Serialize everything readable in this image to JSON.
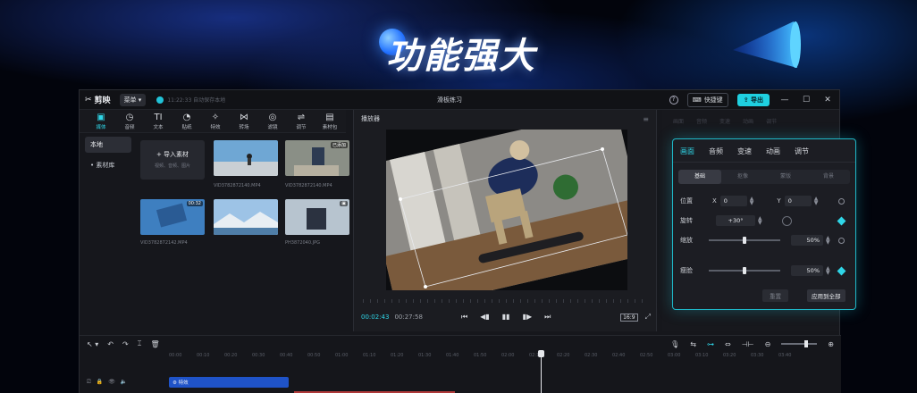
{
  "headline": "功能强大",
  "app": {
    "name": "剪映",
    "menu_label": "菜单",
    "save_status": "11:22:33 自动保存本地",
    "project_title": "滑板练习",
    "shortcut_label": "快捷键",
    "export_label": "导出",
    "help_glyph": "?",
    "minimize_glyph": "—",
    "maximize_glyph": "☐",
    "close_glyph": "✕"
  },
  "toolbar": {
    "items": [
      {
        "icon": "▣",
        "label": "媒体"
      },
      {
        "icon": "◷",
        "label": "音频"
      },
      {
        "icon": "TI",
        "label": "文本"
      },
      {
        "icon": "◔",
        "label": "贴纸"
      },
      {
        "icon": "✧",
        "label": "特效"
      },
      {
        "icon": "⋈",
        "label": "转场"
      },
      {
        "icon": "◎",
        "label": "滤镜"
      },
      {
        "icon": "⇌",
        "label": "调节"
      },
      {
        "icon": "▤",
        "label": "素材包"
      }
    ]
  },
  "left_nav": {
    "items": [
      "本地",
      "• 素材库"
    ]
  },
  "media": {
    "import_label": "+ 导入素材",
    "import_sub": "视频、音频、图片",
    "clips": [
      {
        "name": "VID3782872140.MP4",
        "badge": ""
      },
      {
        "name": "VID3782872140.MP4",
        "badge": "已添加"
      },
      {
        "name": "VID3782872142.MP4",
        "badge": "00:32"
      },
      {
        "name": "",
        "badge": ""
      },
      {
        "name": "PH3872040.JPG",
        "badge": ""
      }
    ]
  },
  "player": {
    "title": "播放器",
    "menu_glyph": "≡",
    "current_time": "00:02:43",
    "total_time": "00:27:58",
    "ratio": "16:9",
    "transport": [
      "⏮",
      "◀▮",
      "▮▮",
      "▮▶",
      "⏭"
    ],
    "fullscreen_glyph": "⤢"
  },
  "right_panel": {
    "faded_tabs": [
      "画面",
      "音频",
      "变速",
      "动画",
      "调节"
    ]
  },
  "inspector": {
    "tabs": [
      "画面",
      "音频",
      "变速",
      "动画",
      "调节"
    ],
    "sub_tabs": [
      "基础",
      "抠像",
      "蒙版",
      "背景"
    ],
    "position_label": "位置",
    "x_label": "X",
    "x_value": "0",
    "y_label": "Y",
    "y_value": "0",
    "rotate_label": "旋转",
    "rotate_value": "+30°",
    "scale_label": "缩放",
    "scale_value": "50%",
    "scale_level": 0.5,
    "blend_label": "瘦脸",
    "blend_value": "50%",
    "blend_level": 0.5,
    "reset_label": "重置",
    "apply_all_label": "应用到全部"
  },
  "timeline": {
    "tools_left": [
      "↖ ▾",
      "↶",
      "↷",
      "⌶",
      "🗑"
    ],
    "tools_right": [
      "🎙",
      "⇆",
      "⊶",
      "⇔",
      "⊣⊢",
      "⊖"
    ],
    "ruler": [
      "00:00",
      "00:10",
      "00:20",
      "00:30",
      "00:40",
      "00:50",
      "01:00",
      "01:10",
      "01:20",
      "01:30",
      "01:40",
      "01:50",
      "02:00",
      "02:10",
      "02:20",
      "02:30",
      "02:40",
      "02:50",
      "03:00",
      "03:10",
      "03:20",
      "03:30",
      "03:40"
    ],
    "clip_label": "⚙ 特效",
    "track_icons": [
      "⎚",
      "🔒",
      "👁",
      "🔈"
    ]
  }
}
